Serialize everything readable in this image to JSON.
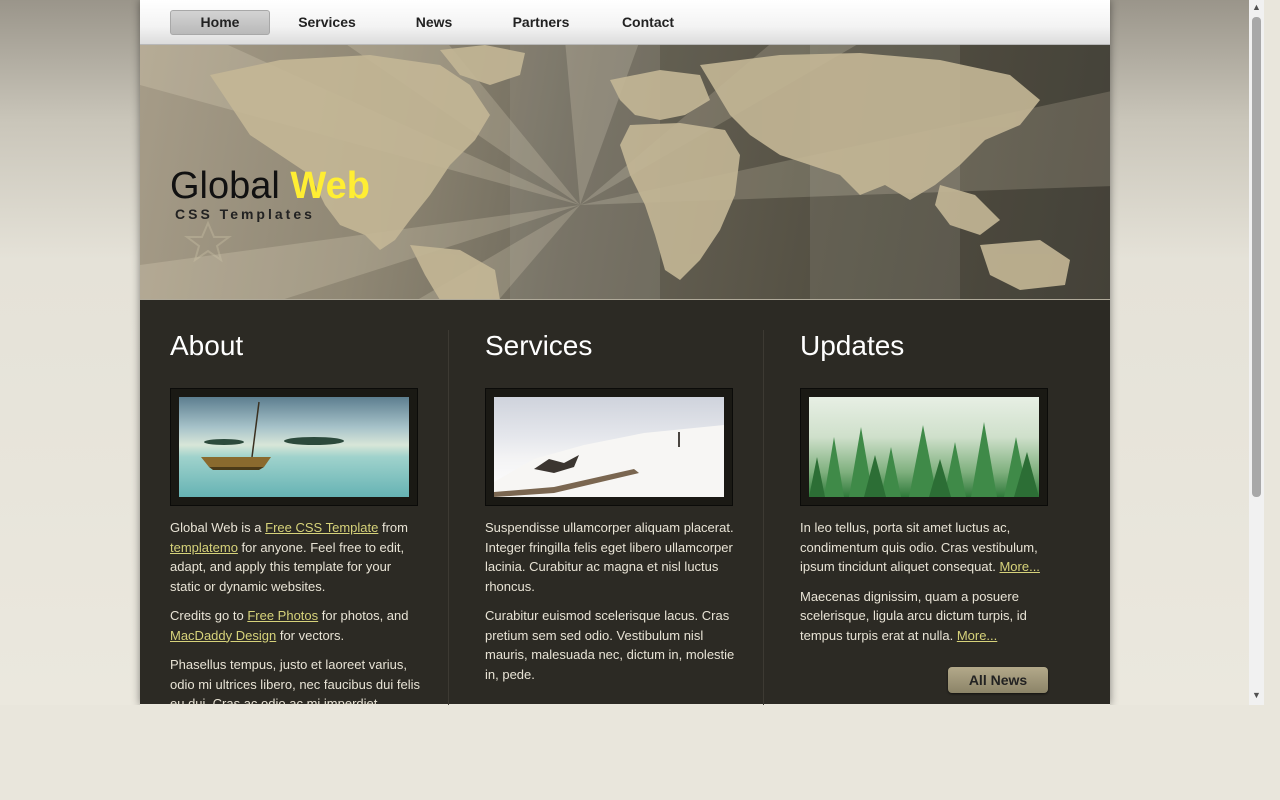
{
  "nav": {
    "items": [
      "Home",
      "Services",
      "News",
      "Partners",
      "Contact"
    ]
  },
  "header": {
    "title_main": "Global",
    "title_accent": "Web",
    "subtitle": "CSS Templates"
  },
  "about": {
    "heading": "About",
    "p1_a": "Global Web is a ",
    "p1_link1": "Free CSS Template",
    "p1_b": " from ",
    "p1_link2": "templatemo",
    "p1_c": " for anyone. Feel free to edit, adapt, and apply this template for your static or dynamic websites.",
    "p2_a": "Credits go to ",
    "p2_link1": "Free Photos",
    "p2_b": " for photos, and ",
    "p2_link2": "MacDaddy Design",
    "p2_c": " for vectors.",
    "p3": "Phasellus tempus, justo et laoreet varius, odio mi ultrices libero, nec faucibus dui felis eu dui. Cras ac odio ac mi imperdiet"
  },
  "services": {
    "heading": "Services",
    "p1": "Suspendisse ullamcorper aliquam placerat. Integer fringilla felis eget libero ullamcorper lacinia. Curabitur ac magna et nisl luctus rhoncus.",
    "p2": "Curabitur euismod scelerisque lacus. Cras pretium sem sed odio. Vestibulum nisl mauris, malesuada nec, dictum in, molestie in, pede."
  },
  "updates": {
    "heading": "Updates",
    "p1": "In leo tellus, porta sit amet luctus ac, condimentum quis odio. Cras vestibulum, ipsum tincidunt aliquet consequat. ",
    "p1_more": "More...",
    "p2": "Maecenas dignissim, quam a posuere scelerisque, ligula arcu dictum turpis, id tempus turpis erat at nulla. ",
    "p2_more": "More...",
    "button": "All News"
  },
  "colors": {
    "accent": "#ffee33",
    "content_bg": "#2c2a24",
    "link": "#d6d27a"
  }
}
